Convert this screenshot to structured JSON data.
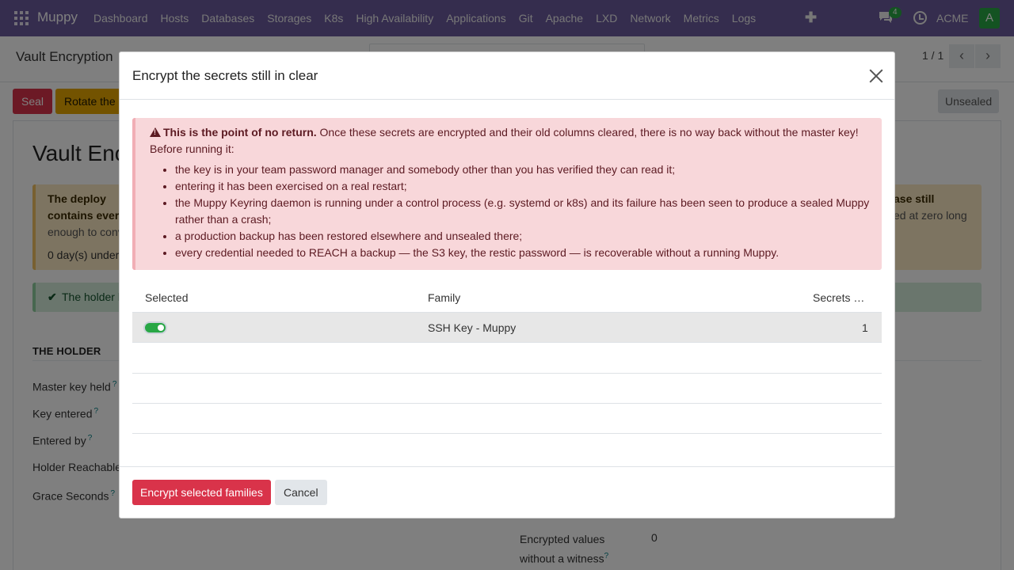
{
  "navbar": {
    "brand": "Muppy",
    "menu": [
      "Dashboard",
      "Hosts",
      "Databases",
      "Storages",
      "K8s",
      "High Availability",
      "Applications",
      "Git",
      "Apache",
      "LXD",
      "Network",
      "Metrics",
      "Logs"
    ],
    "plus": "✚",
    "chat_count": "4",
    "company": "ACME",
    "avatar": "A"
  },
  "control": {
    "breadcrumb": "Vault Encryption",
    "pager": "1 / 1",
    "prev": "‹",
    "next": "›"
  },
  "header_buttons": {
    "seal": "Seal",
    "rotate": "Rotate the",
    "status": "Unsealed"
  },
  "form": {
    "title": "Vault Enc",
    "warning": {
      "line1": "The deploy",
      "line2": "contains ever",
      "line3": "enough to conv",
      "line4": "0 day(s) under",
      "right1": "ase still",
      "right2": "ed at zero long"
    },
    "ok_text": "The holder l",
    "ok_icon": "✔",
    "holder_heading": "THE HOLDER",
    "fields": [
      "Master key held",
      "Key entered",
      "Entered by",
      "Holder Reachable",
      "Grace Seconds"
    ],
    "help": "?",
    "encrypted_label_1": "Encrypted values",
    "encrypted_label_2": "without a witness",
    "encrypted_value": "0"
  },
  "modal": {
    "title": "Encrypt the secrets still in clear",
    "alert_bold": "This is the point of no return.",
    "alert_rest": " Once these secrets are encrypted and their old columns cleared, there is no way back without the master key!",
    "alert_before": "Before running it:",
    "alert_items": [
      "the key is in your team password manager and somebody other than you has verified they can read it;",
      "entering it has been exercised on a real restart;",
      "the Muppy Keyring daemon is running under a control process (e.g. systemd or k8s) and its failure has been seen to produce a sealed Muppy rather than a crash;",
      "a production backup has been restored elsewhere and unsealed there;",
      "every credential needed to REACH a backup — the S3 key, the restic password — is recoverable without a running Muppy."
    ],
    "table": {
      "headers": [
        "Selected",
        "Family",
        "Secrets …"
      ],
      "rows": [
        {
          "selected": true,
          "family": "SSH Key - Muppy",
          "secrets": "1"
        }
      ]
    },
    "encrypt_button": "Encrypt selected families",
    "cancel_button": "Cancel"
  }
}
